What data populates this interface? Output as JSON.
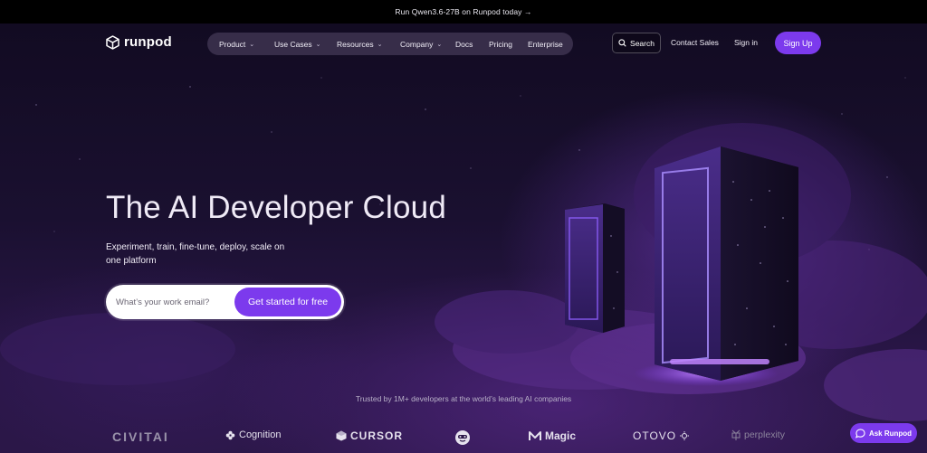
{
  "announcement": {
    "text": "Run Qwen3.6-27B on Runpod today →"
  },
  "brand": {
    "name": "runpod"
  },
  "nav": {
    "items": [
      {
        "label": "Product",
        "has_menu": true
      },
      {
        "label": "Use Cases",
        "has_menu": true
      },
      {
        "label": "Resources",
        "has_menu": true
      },
      {
        "label": "Company",
        "has_menu": true
      },
      {
        "label": "Docs",
        "has_menu": false
      },
      {
        "label": "Pricing",
        "has_menu": false
      },
      {
        "label": "Enterprise",
        "has_menu": false
      }
    ],
    "search_label": "Search",
    "contact_label": "Contact Sales",
    "signin_label": "Sign in",
    "signup_label": "Sign Up"
  },
  "hero": {
    "title": "The AI Developer Cloud",
    "subtitle": "Experiment, train, fine-tune, deploy, scale on one platform",
    "email_placeholder": "What’s your work email?",
    "cta_label": "Get started for free"
  },
  "trusted": {
    "text": "Trusted by 1M+ developers at the world’s leading AI companies",
    "logos": [
      "CIVITAI",
      "Cognition",
      "CURSOR",
      "mascot-icon",
      "Magic",
      "OTOVO",
      "perplexity"
    ]
  },
  "chat": {
    "label": "Ask Runpod"
  },
  "colors": {
    "accent": "#7c3aed",
    "background": "#120a22",
    "announcement_bar": "#000000"
  }
}
